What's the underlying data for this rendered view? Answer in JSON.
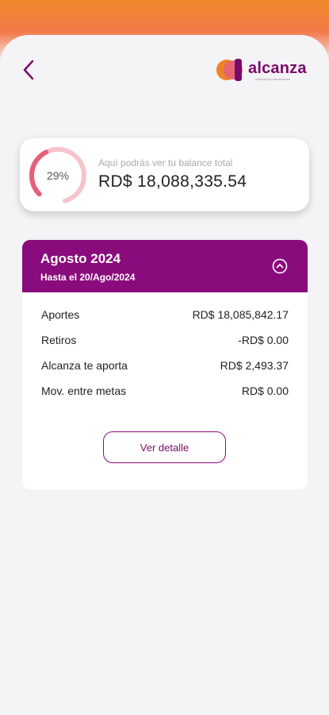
{
  "brand": {
    "name": "alcanza",
    "tagline": "powered by banreservas",
    "colors": {
      "primary": "#8a0b7c",
      "orange": "#f08a2a",
      "pink": "#e6607a"
    }
  },
  "balance": {
    "percent_label": "29%",
    "percent_value": 0.29,
    "hint": "Aquí podrás ver tu balance total",
    "total": "RD$ 18,088,335.54"
  },
  "period": {
    "title": "Agosto 2024",
    "subtitle": "Hasta el 20/Ago/2024",
    "rows": [
      {
        "label": "Aportes",
        "value": "RD$ 18,085,842.17"
      },
      {
        "label": "Retiros",
        "value": "-RD$ 0.00"
      },
      {
        "label": "Alcanza te aporta",
        "value": "RD$ 2,493.37"
      },
      {
        "label": "Mov. entre metas",
        "value": "RD$ 0.00"
      }
    ],
    "detail_button": "Ver detalle"
  },
  "icons": {
    "back": "chevron-left-icon",
    "collapse": "chevron-up-circle-icon",
    "logo": "alcanza-logo-icon"
  }
}
